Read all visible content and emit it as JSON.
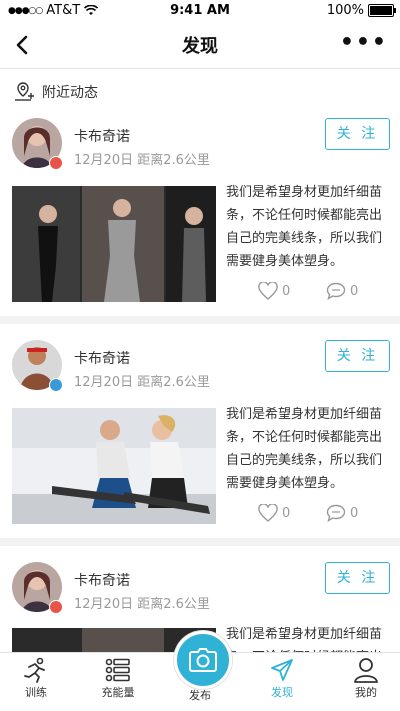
{
  "status_bar": {
    "carrier": "AT&T",
    "time": "9:41 AM",
    "battery": "100%"
  },
  "header": {
    "title": "发现",
    "back_icon": "chevron-left-icon",
    "more_icon": "more-dots-icon"
  },
  "section": {
    "label": "附近动态",
    "icon": "location-person-icon"
  },
  "posts": [
    {
      "name": "卡布奇诺",
      "date": "12月20日",
      "distance": "距离2.6公里",
      "follow_label": "关 注",
      "text": "我们是希望身材更加纤细苗条，不论任何时候都能亮出自己的完美线条，所以我们需要健身美体塑身。",
      "likes": "0",
      "comments": "0",
      "badge": "gender-female-icon",
      "badge_color": "#e8534a"
    },
    {
      "name": "卡布奇诺",
      "date": "12月20日",
      "distance": "距离2.6公里",
      "follow_label": "关 注",
      "text": "我们是希望身材更加纤细苗条，不论任何时候都能亮出自己的完美线条，所以我们需要健身美体塑身。",
      "likes": "0",
      "comments": "0",
      "badge": "gender-male-icon",
      "badge_color": "#3a9ad9"
    },
    {
      "name": "卡布奇诺",
      "date": "12月20日",
      "distance": "距离2.6公里",
      "follow_label": "关 注",
      "text": "我们是希望身材更加纤细苗条，不论任何时候都能亮出",
      "badge": "gender-female-icon",
      "badge_color": "#e8534a"
    }
  ],
  "tabbar": {
    "tabs": [
      {
        "label": "训练",
        "icon": "runner-icon"
      },
      {
        "label": "充能量",
        "icon": "list-icon"
      },
      {
        "label": "发布",
        "icon": "camera-icon"
      },
      {
        "label": "发现",
        "icon": "send-icon",
        "active": true
      },
      {
        "label": "我的",
        "icon": "user-icon"
      }
    ],
    "accent": "#2fb2d6"
  }
}
